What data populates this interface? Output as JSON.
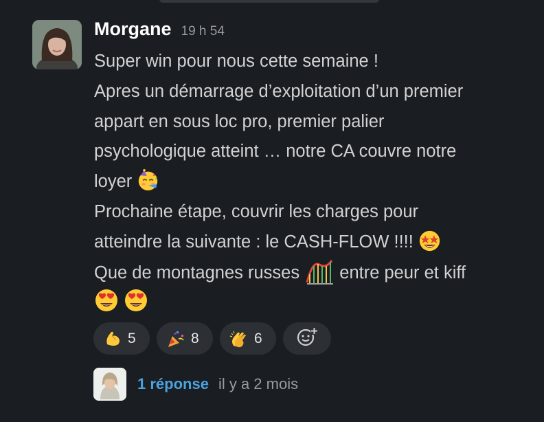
{
  "message": {
    "author": "Morgane",
    "timestamp": "19 h 54",
    "lines": [
      "Super win pour nous cette semaine !",
      "Apres un démarrage d’exploitation d’un premier",
      "appart en sous loc pro, premier palier",
      "psychologique atteint … notre CA couvre notre",
      "loyer",
      "Prochaine étape, couvrir les charges pour",
      "atteindre la suivante : le CASH-FLOW !!!!",
      "Que de montagnes russes",
      "entre peur et kiff"
    ],
    "emojis": {
      "loyer_end": "partying-face",
      "cashflow_end": "star-struck",
      "montagnes_mid": "roller-coaster",
      "last_line": [
        "heart-eyes-face",
        "heart-eyes-face"
      ]
    }
  },
  "reactions": [
    {
      "emoji": "flexed-biceps",
      "count": "5"
    },
    {
      "emoji": "party-popper",
      "count": "8"
    },
    {
      "emoji": "clapping-hands",
      "count": "6"
    }
  ],
  "add_reaction_icon": "add-reaction-icon",
  "thread": {
    "replies_label": "1 réponse",
    "last_reply": "il y a 2 mois"
  },
  "colors": {
    "background": "#1a1d21",
    "text": "#d1d2d3",
    "link": "#4aa3df",
    "muted": "#9a9b9d",
    "chip": "#2c2f33"
  }
}
